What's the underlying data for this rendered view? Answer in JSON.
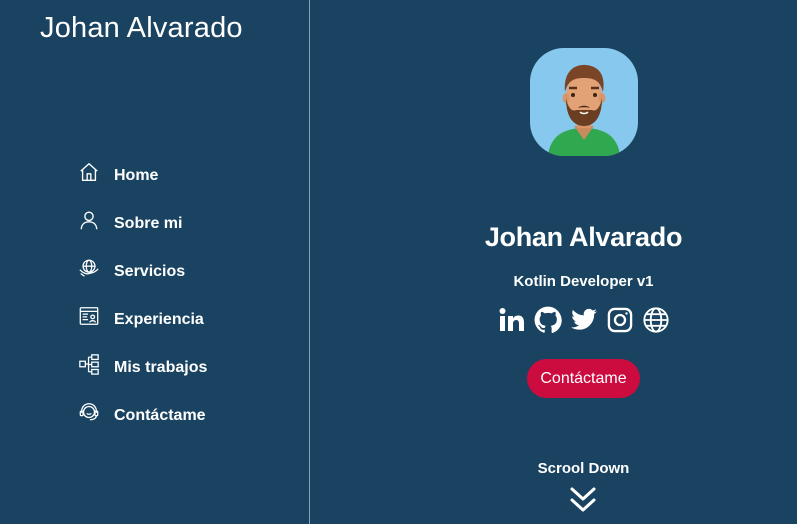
{
  "sidebar": {
    "brand": "Johan Alvarado",
    "items": [
      {
        "label": "Home",
        "icon": "home-icon"
      },
      {
        "label": "Sobre mi",
        "icon": "user-icon"
      },
      {
        "label": "Servicios",
        "icon": "services-icon"
      },
      {
        "label": "Experiencia",
        "icon": "experience-icon"
      },
      {
        "label": "Mis trabajos",
        "icon": "sitemap-icon"
      },
      {
        "label": "Contáctame",
        "icon": "headset-icon"
      }
    ]
  },
  "profile": {
    "name": "Johan Alvarado",
    "role": "Kotlin Developer v1",
    "social": [
      "linkedin-icon",
      "github-icon",
      "twitter-icon",
      "instagram-icon",
      "globe-icon"
    ],
    "contact_label": "Contáctame",
    "scroll_label": "Scrool Down"
  },
  "colors": {
    "background": "#1a4361",
    "accent": "#cc0b3f",
    "avatar_bg": "#87c9ee"
  }
}
